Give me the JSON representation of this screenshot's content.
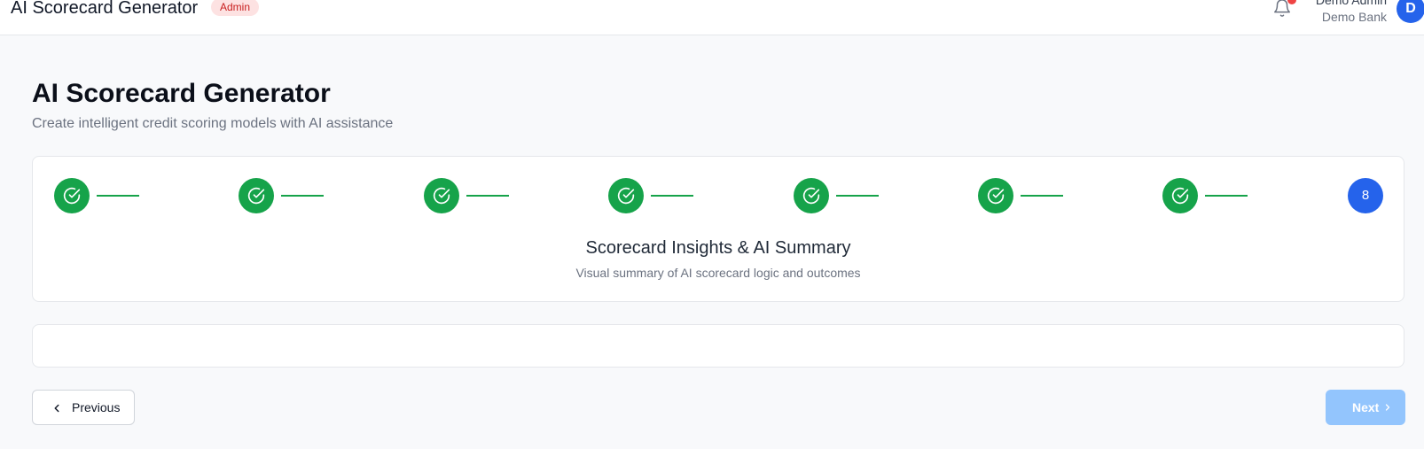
{
  "header": {
    "app_title": "AI Scorecard Generator",
    "role_badge": "Admin",
    "user_name": "Demo Admin",
    "user_org": "Demo Bank",
    "avatar_initial": "D"
  },
  "page": {
    "title": "AI Scorecard Generator",
    "subtitle": "Create intelligent credit scoring models with AI assistance"
  },
  "stepper": {
    "completed_steps": 7,
    "current_step": "8",
    "current_title": "Scorecard Insights & AI Summary",
    "current_description": "Visual summary of AI scorecard logic and outcomes"
  },
  "nav": {
    "previous_label": "Previous",
    "next_label": "Next",
    "next_disabled": true
  },
  "colors": {
    "done": "#16a34a",
    "current": "#2563eb",
    "next_disabled": "#93c5fd"
  }
}
